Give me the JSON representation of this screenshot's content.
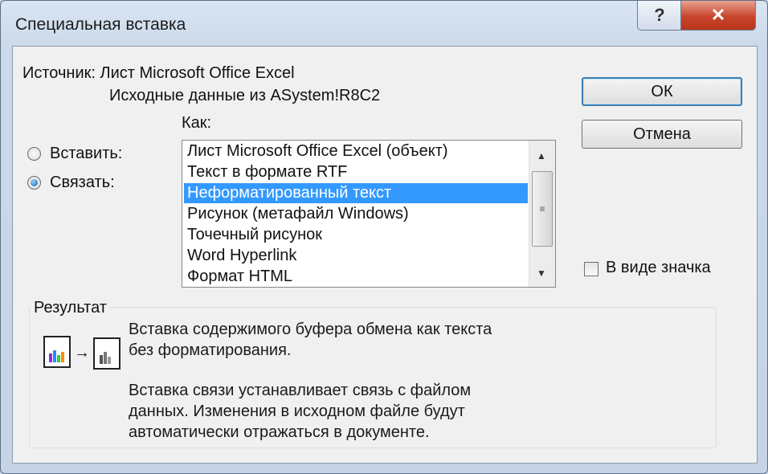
{
  "window": {
    "title": "Специальная вставка",
    "help_label": "?",
    "close_label": "✕"
  },
  "source": {
    "label": "Источник: Лист Microsoft Office Excel",
    "detail": "Исходные данные из ASystem!R8C2"
  },
  "as_label": "Как:",
  "mode": {
    "paste_label": "Вставить:",
    "link_label": "Связать:",
    "selected": "link"
  },
  "formats": {
    "items": [
      "Лист Microsoft Office Excel (объект)",
      "Текст в формате RTF",
      "Неформатированный текст",
      "Рисунок (метафайл Windows)",
      "Точечный рисунок",
      "Word Hyperlink",
      "Формат HTML"
    ],
    "selected_index": 2
  },
  "buttons": {
    "ok_label": "ОК",
    "cancel_label": "Отмена"
  },
  "display_as_icon": {
    "label": "В виде значка",
    "checked": false
  },
  "result": {
    "label": "Результат",
    "line1": "Вставка содержимого буфера обмена как текста",
    "line2": "без форматирования.",
    "line3": "Вставка связи устанавливает связь с файлом",
    "line4": "данных. Изменения в исходном файле будут",
    "line5": "автоматически отражаться в документе."
  },
  "colors": {
    "selection": "#3399ff",
    "close_button": "#c8442a"
  }
}
